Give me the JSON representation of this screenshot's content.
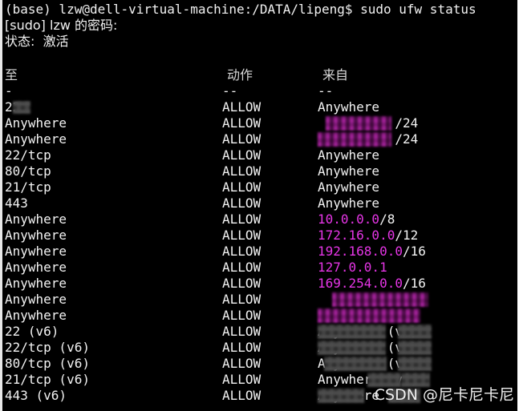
{
  "terminal": {
    "prompt_line": "(base) lzw@dell-virtual-machine:/DATA/lipeng$ sudo ufw status",
    "sudo_line": "[sudo] lzw 的密码:",
    "status_line": "状态:  激活",
    "colors": {
      "background": "#000000",
      "foreground": "#f2f2f2",
      "ip_magenta": "#e635e6"
    }
  },
  "table": {
    "headers": {
      "to": "至",
      "action": "动作",
      "from": "来自"
    },
    "separators": {
      "to": "-",
      "action": "--",
      "from": "--"
    },
    "rows": [
      {
        "to": "22",
        "to_redacted": true,
        "action": "ALLOW",
        "from": "Anywhere",
        "from_redacted": false,
        "from_kind": "plain"
      },
      {
        "to": "Anywhere",
        "to_redacted": false,
        "action": "ALLOW",
        "from": "/24",
        "from_redacted": true,
        "from_kind": "cidr"
      },
      {
        "to": "Anywhere",
        "to_redacted": false,
        "action": "ALLOW",
        "from": "/24",
        "from_redacted": true,
        "from_kind": "cidr"
      },
      {
        "to": "22/tcp",
        "to_redacted": false,
        "action": "ALLOW",
        "from": "Anywhere",
        "from_redacted": false,
        "from_kind": "plain"
      },
      {
        "to": "80/tcp",
        "to_redacted": false,
        "action": "ALLOW",
        "from": "Anywhere",
        "from_redacted": false,
        "from_kind": "plain"
      },
      {
        "to": "21/tcp",
        "to_redacted": false,
        "action": "ALLOW",
        "from": "Anywhere",
        "from_redacted": false,
        "from_kind": "plain"
      },
      {
        "to": "443",
        "to_redacted": false,
        "action": "ALLOW",
        "from": "Anywhere",
        "from_redacted": false,
        "from_kind": "plain"
      },
      {
        "to": "Anywhere",
        "to_redacted": false,
        "action": "ALLOW",
        "from": "10.0.0.0",
        "from_suffix": "/8",
        "from_redacted": false,
        "from_kind": "ip"
      },
      {
        "to": "Anywhere",
        "to_redacted": false,
        "action": "ALLOW",
        "from": "172.16.0.0",
        "from_suffix": "/12",
        "from_redacted": false,
        "from_kind": "ip"
      },
      {
        "to": "Anywhere",
        "to_redacted": false,
        "action": "ALLOW",
        "from": "192.168.0.0",
        "from_suffix": "/16",
        "from_redacted": false,
        "from_kind": "ip"
      },
      {
        "to": "Anywhere",
        "to_redacted": false,
        "action": "ALLOW",
        "from": "127.0.0.1",
        "from_suffix": "",
        "from_redacted": false,
        "from_kind": "ip"
      },
      {
        "to": "Anywhere",
        "to_redacted": false,
        "action": "ALLOW",
        "from": "169.254.0.0",
        "from_suffix": "/16",
        "from_redacted": false,
        "from_kind": "ip"
      },
      {
        "to": "Anywhere",
        "to_redacted": false,
        "action": "ALLOW",
        "from": "",
        "from_redacted": true,
        "from_kind": "ip"
      },
      {
        "to": "Anywhere",
        "to_redacted": false,
        "action": "ALLOW",
        "from": "",
        "from_redacted": true,
        "from_kind": "ip"
      },
      {
        "to": "22 (v6)",
        "to_redacted": false,
        "action": "ALLOW",
        "from": "Anywhere (v6)",
        "from_redacted": true,
        "from_kind": "plain"
      },
      {
        "to": "22/tcp (v6)",
        "to_redacted": false,
        "action": "ALLOW",
        "from": "Anywhere (v6)",
        "from_redacted": true,
        "from_kind": "plain"
      },
      {
        "to": "80/tcp (v6)",
        "to_redacted": false,
        "action": "ALLOW",
        "from": "Anywhere (v6)",
        "from_redacted": true,
        "from_kind": "plain"
      },
      {
        "to": "21/tcp (v6)",
        "to_redacted": false,
        "action": "ALLOW",
        "from": "Anywhere (v6)",
        "from_redacted": true,
        "from_kind": "plain"
      },
      {
        "to": "443 (v6)",
        "to_redacted": false,
        "action": "ALLOW",
        "from": "Anywhere (v6)",
        "from_redacted": true,
        "from_kind": "plain"
      }
    ]
  },
  "watermark": {
    "text": "CSDN @尼卡尼卡尼"
  }
}
